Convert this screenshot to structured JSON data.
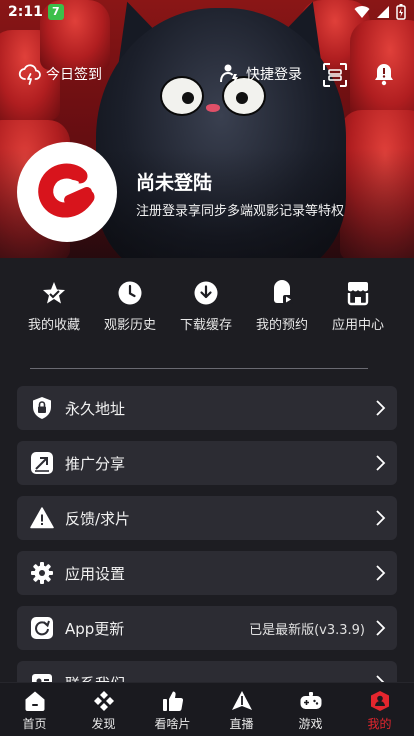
{
  "status_bar": {
    "time": "2:11",
    "notification_badge": "7"
  },
  "header": {
    "checkin_label": "今日签到",
    "quick_login_label": "快捷登录"
  },
  "profile": {
    "username": "尚未登陆",
    "subtitle": "注册登录享同步多端观影记录等特权"
  },
  "quick_actions": [
    {
      "label": "我的收藏",
      "icon": "star-check-icon"
    },
    {
      "label": "观影历史",
      "icon": "clock-icon"
    },
    {
      "label": "下载缓存",
      "icon": "download-icon"
    },
    {
      "label": "我的预约",
      "icon": "reservation-icon"
    },
    {
      "label": "应用中心",
      "icon": "app-store-icon"
    }
  ],
  "menu": [
    {
      "label": "永久地址",
      "icon": "shield-lock-icon",
      "value": ""
    },
    {
      "label": "推广分享",
      "icon": "share-icon",
      "value": ""
    },
    {
      "label": "反馈/求片",
      "icon": "warning-icon",
      "value": ""
    },
    {
      "label": "应用设置",
      "icon": "gear-icon",
      "value": ""
    },
    {
      "label": "App更新",
      "icon": "update-icon",
      "value": "已是最新版(v3.3.9)"
    },
    {
      "label": "联系我们",
      "icon": "contact-icon",
      "value": ""
    }
  ],
  "tabs": [
    {
      "label": "首页",
      "icon": "home-icon",
      "active": false
    },
    {
      "label": "发现",
      "icon": "discover-icon",
      "active": false
    },
    {
      "label": "看啥片",
      "icon": "thumbs-up-icon",
      "active": false
    },
    {
      "label": "直播",
      "icon": "live-icon",
      "active": false
    },
    {
      "label": "游戏",
      "icon": "gamepad-icon",
      "active": false
    },
    {
      "label": "我的",
      "icon": "profile-icon",
      "active": true
    }
  ],
  "colors": {
    "accent": "#e4262e",
    "background": "#1d1d22",
    "row_background": "#2c2c33",
    "badge_green": "#3cbf4a"
  }
}
